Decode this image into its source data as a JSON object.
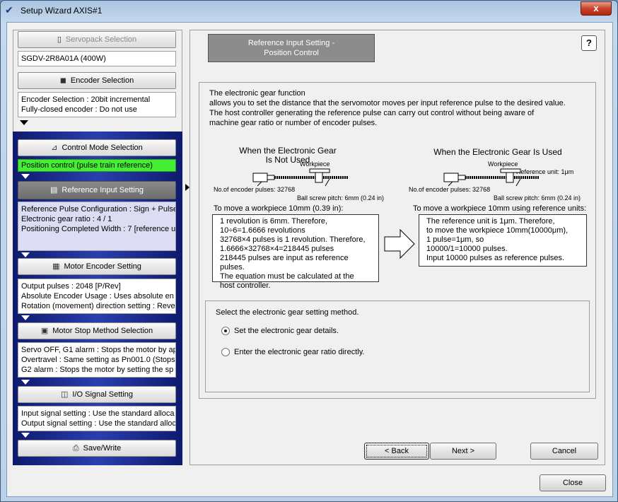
{
  "window": {
    "title": "Setup Wizard AXIS#1",
    "close_glyph": "x"
  },
  "left": {
    "servopack_btn": "Servopack Selection",
    "servopack_info": "SGDV-2R8A01A (400W)",
    "encoder_btn": "Encoder Selection",
    "encoder_info": [
      "Encoder Selection : 20bit incremental",
      "Fully-closed encoder : Do not use"
    ],
    "control_mode_btn": "Control Mode Selection",
    "control_mode_info": "Position control (pulse train reference)",
    "reference_input_btn": "Reference Input Setting",
    "reference_input_info": [
      "Reference Pulse Configuration : Sign + Pulse",
      "Electronic gear ratio : 4 / 1",
      "Positioning Completed Width : 7 [reference u"
    ],
    "motor_encoder_btn": "Motor Encoder Setting",
    "motor_encoder_info": [
      "Output pulses : 2048 [P/Rev]",
      "Absolute Encoder Usage : Uses absolute en",
      "Rotation (movement) direction setting : Reve"
    ],
    "motor_stop_btn": "Motor Stop Method Selection",
    "motor_stop_info": [
      "Servo OFF, G1 alarm : Stops the motor by ap",
      "Overtravel : Same setting as Pn001.0 (Stops",
      "G2 alarm : Stops the motor by setting the sp"
    ],
    "io_btn": "I/O Signal Setting",
    "io_info": [
      "Input signal setting : Use the standard alloca",
      "Output signal setting : Use the standard alloc"
    ],
    "save_btn": "Save/Write"
  },
  "main": {
    "heading": [
      "Reference Input Setting -",
      "Position Control"
    ],
    "help": "?",
    "desc": [
      "The electronic gear function",
      "allows you to set the distance that the servomotor moves per input reference pulse to the desired value.",
      "The host controller generating the reference pulse can carry out control without being aware of",
      "machine gear ratio or number of encoder pulses."
    ],
    "left_diag_title": [
      "When the Electronic Gear",
      "Is Not Used"
    ],
    "right_diag_title": "When the Electronic Gear Is Used",
    "workpiece": "Workpiece",
    "encoder_pulses": "No.of encoder pulses: 32768",
    "ball_screw": "Ball screw pitch: 6mm (0.24 in)",
    "ref_unit": "Reference unit: 1μm",
    "left_move": "To move a workpiece 10mm (0.39 in):",
    "right_move": "To move a workpiece 10mm using reference units:",
    "left_box": [
      "1 revolution is 6mm. Therefore,",
      "10÷6=1.6666 revolutions",
      "32768×4 pulses is 1 revolution. Therefore,",
      "1.6666×32768×4=218445 pulses",
      "218445 pulses are input as reference pulses.",
      "The equation must be calculated at the",
      "host controller."
    ],
    "right_box": [
      "The reference unit is 1μm. Therefore,",
      "to move the workpiece 10mm(10000μm),",
      "1 pulse=1μm, so",
      "10000/1=10000 pulses.",
      "Input 10000 pulses as reference pulses."
    ],
    "choice_prompt": "Select the electronic gear setting method.",
    "option1": "Set the electronic gear details.",
    "option2": "Enter the electronic gear ratio directly."
  },
  "buttons": {
    "back": "< Back",
    "next": "Next >",
    "cancel": "Cancel",
    "close": "Close"
  }
}
